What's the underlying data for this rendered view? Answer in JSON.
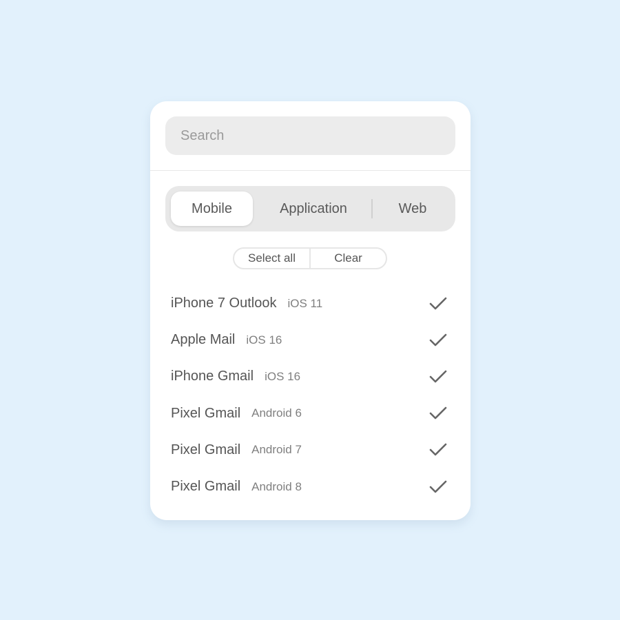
{
  "search": {
    "placeholder": "Search",
    "value": ""
  },
  "tabs": [
    {
      "label": "Mobile",
      "active": true
    },
    {
      "label": "Application",
      "active": false
    },
    {
      "label": "Web",
      "active": false
    }
  ],
  "actions": {
    "select_all": "Select all",
    "clear": "Clear"
  },
  "clients": [
    {
      "name": "iPhone 7 Outlook",
      "os": "iOS 11",
      "checked": true
    },
    {
      "name": "Apple Mail",
      "os": "iOS 16",
      "checked": true
    },
    {
      "name": "iPhone Gmail",
      "os": "iOS 16",
      "checked": true
    },
    {
      "name": "Pixel Gmail",
      "os": "Android 6",
      "checked": true
    },
    {
      "name": "Pixel Gmail",
      "os": "Android 7",
      "checked": true
    },
    {
      "name": "Pixel Gmail",
      "os": "Android 8",
      "checked": true
    }
  ],
  "colors": {
    "background": "#e2f1fc",
    "panel": "#ffffff",
    "segment_track": "#e8e8e8",
    "text": "#555555",
    "check": "#666666"
  },
  "icons": {
    "check": "checkmark-icon"
  }
}
